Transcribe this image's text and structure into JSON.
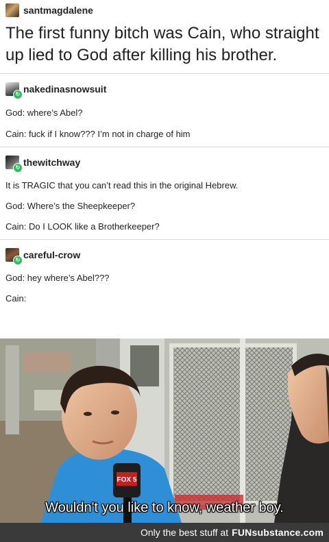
{
  "op": {
    "username": "santmagdalene",
    "text": "The first funny bitch was Cain, who straight up lied to God after killing his brother."
  },
  "replies": [
    {
      "username": "nakedinasnowsuit",
      "lines": [
        "God: where’s Abel?",
        "Cain: fuck if I know??? I’m not in charge of him"
      ]
    },
    {
      "username": "thewitchway",
      "lines": [
        "It is TRAGIC that you can’t read this in the original Hebrew.",
        "God:  Where’s the Sheepkeeper?",
        "Cain: Do I LOOK like a Brotherkeeper?"
      ]
    },
    {
      "username": "careful-crow",
      "lines": [
        "God: hey where’s Abel???",
        "Cain:"
      ]
    }
  ],
  "meme": {
    "caption": "Wouldn't you like to know, weather boy.",
    "mic_logo": "FOX 5"
  },
  "footer": {
    "prefix": "Only the best stuff at",
    "brand": "FUNsubstance.com"
  },
  "icons": {
    "badge": "reblog-badge-icon"
  }
}
